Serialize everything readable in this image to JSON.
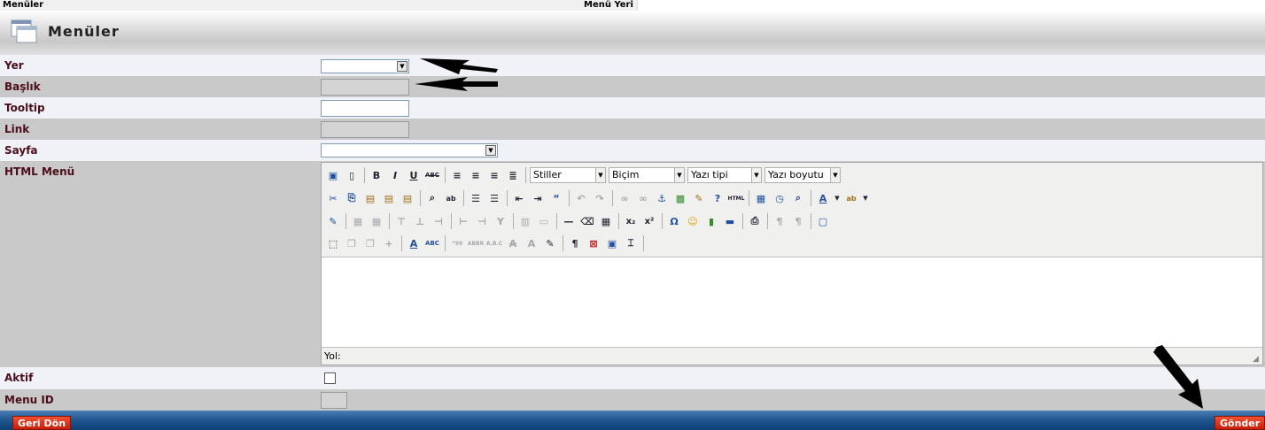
{
  "topbar": {
    "col1": "Menüler",
    "col2": "Menü Yeri"
  },
  "header": {
    "title": "Menüler"
  },
  "form": {
    "yer_label": "Yer",
    "baslik_label": "Başlık",
    "tooltip_label": "Tooltip",
    "link_label": "Link",
    "sayfa_label": "Sayfa",
    "html_menu_label": "HTML Menü",
    "aktif_label": "Aktif",
    "menu_id_label": "Menu ID"
  },
  "editor": {
    "stiller": "Stiller",
    "bicim": "Biçim",
    "yazi_tipi": "Yazı tipi",
    "yazi_boyutu": "Yazı boyutu",
    "path_label": "Yol:"
  },
  "footer": {
    "back": "Geri Dön",
    "submit": "Gönder"
  },
  "colors": {
    "label": "#4a0e1a",
    "footer": "#1e558f",
    "button": "#d92a10"
  }
}
